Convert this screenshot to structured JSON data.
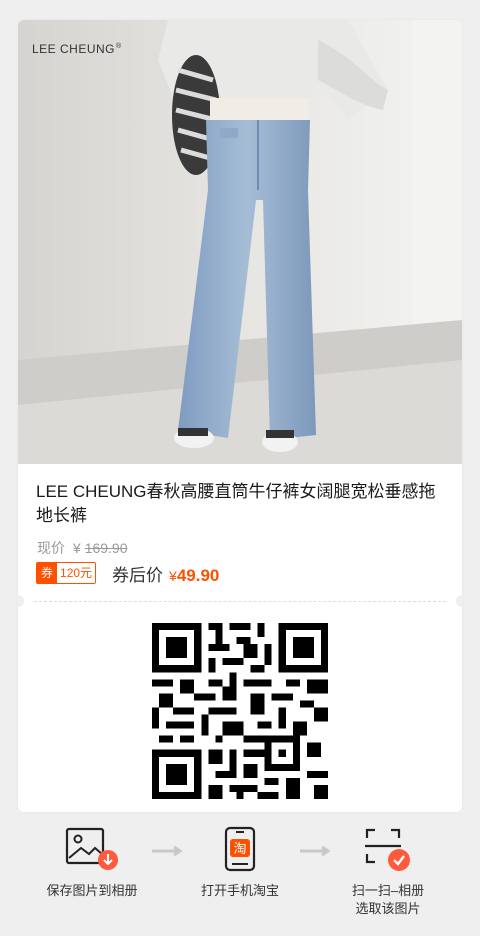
{
  "card": {
    "brand": "LEE CHEUNG",
    "brand_mark": "®",
    "title": "LEE CHEUNG春秋高腰直筒牛仔裤女阔腿宽松垂感拖地长裤",
    "price_label": "现价",
    "price_currency": "¥",
    "price_original": "169.90",
    "coupon_tag": "券",
    "coupon_amount": "120元",
    "after_coupon_label": "券后价",
    "final_currency": "¥",
    "final_price": "49.90"
  },
  "steps": [
    {
      "label": "保存图片到相册",
      "icon": "image-download-icon"
    },
    {
      "label": "打开手机淘宝",
      "icon": "taobao-phone-icon",
      "glyph": "淘"
    },
    {
      "label_line1": "扫一扫–相册",
      "label_line2": "选取该图片",
      "icon": "scan-check-icon"
    }
  ],
  "colors": {
    "accent": "#ff5000",
    "background": "#efefef",
    "text": "#1a1a1a"
  }
}
